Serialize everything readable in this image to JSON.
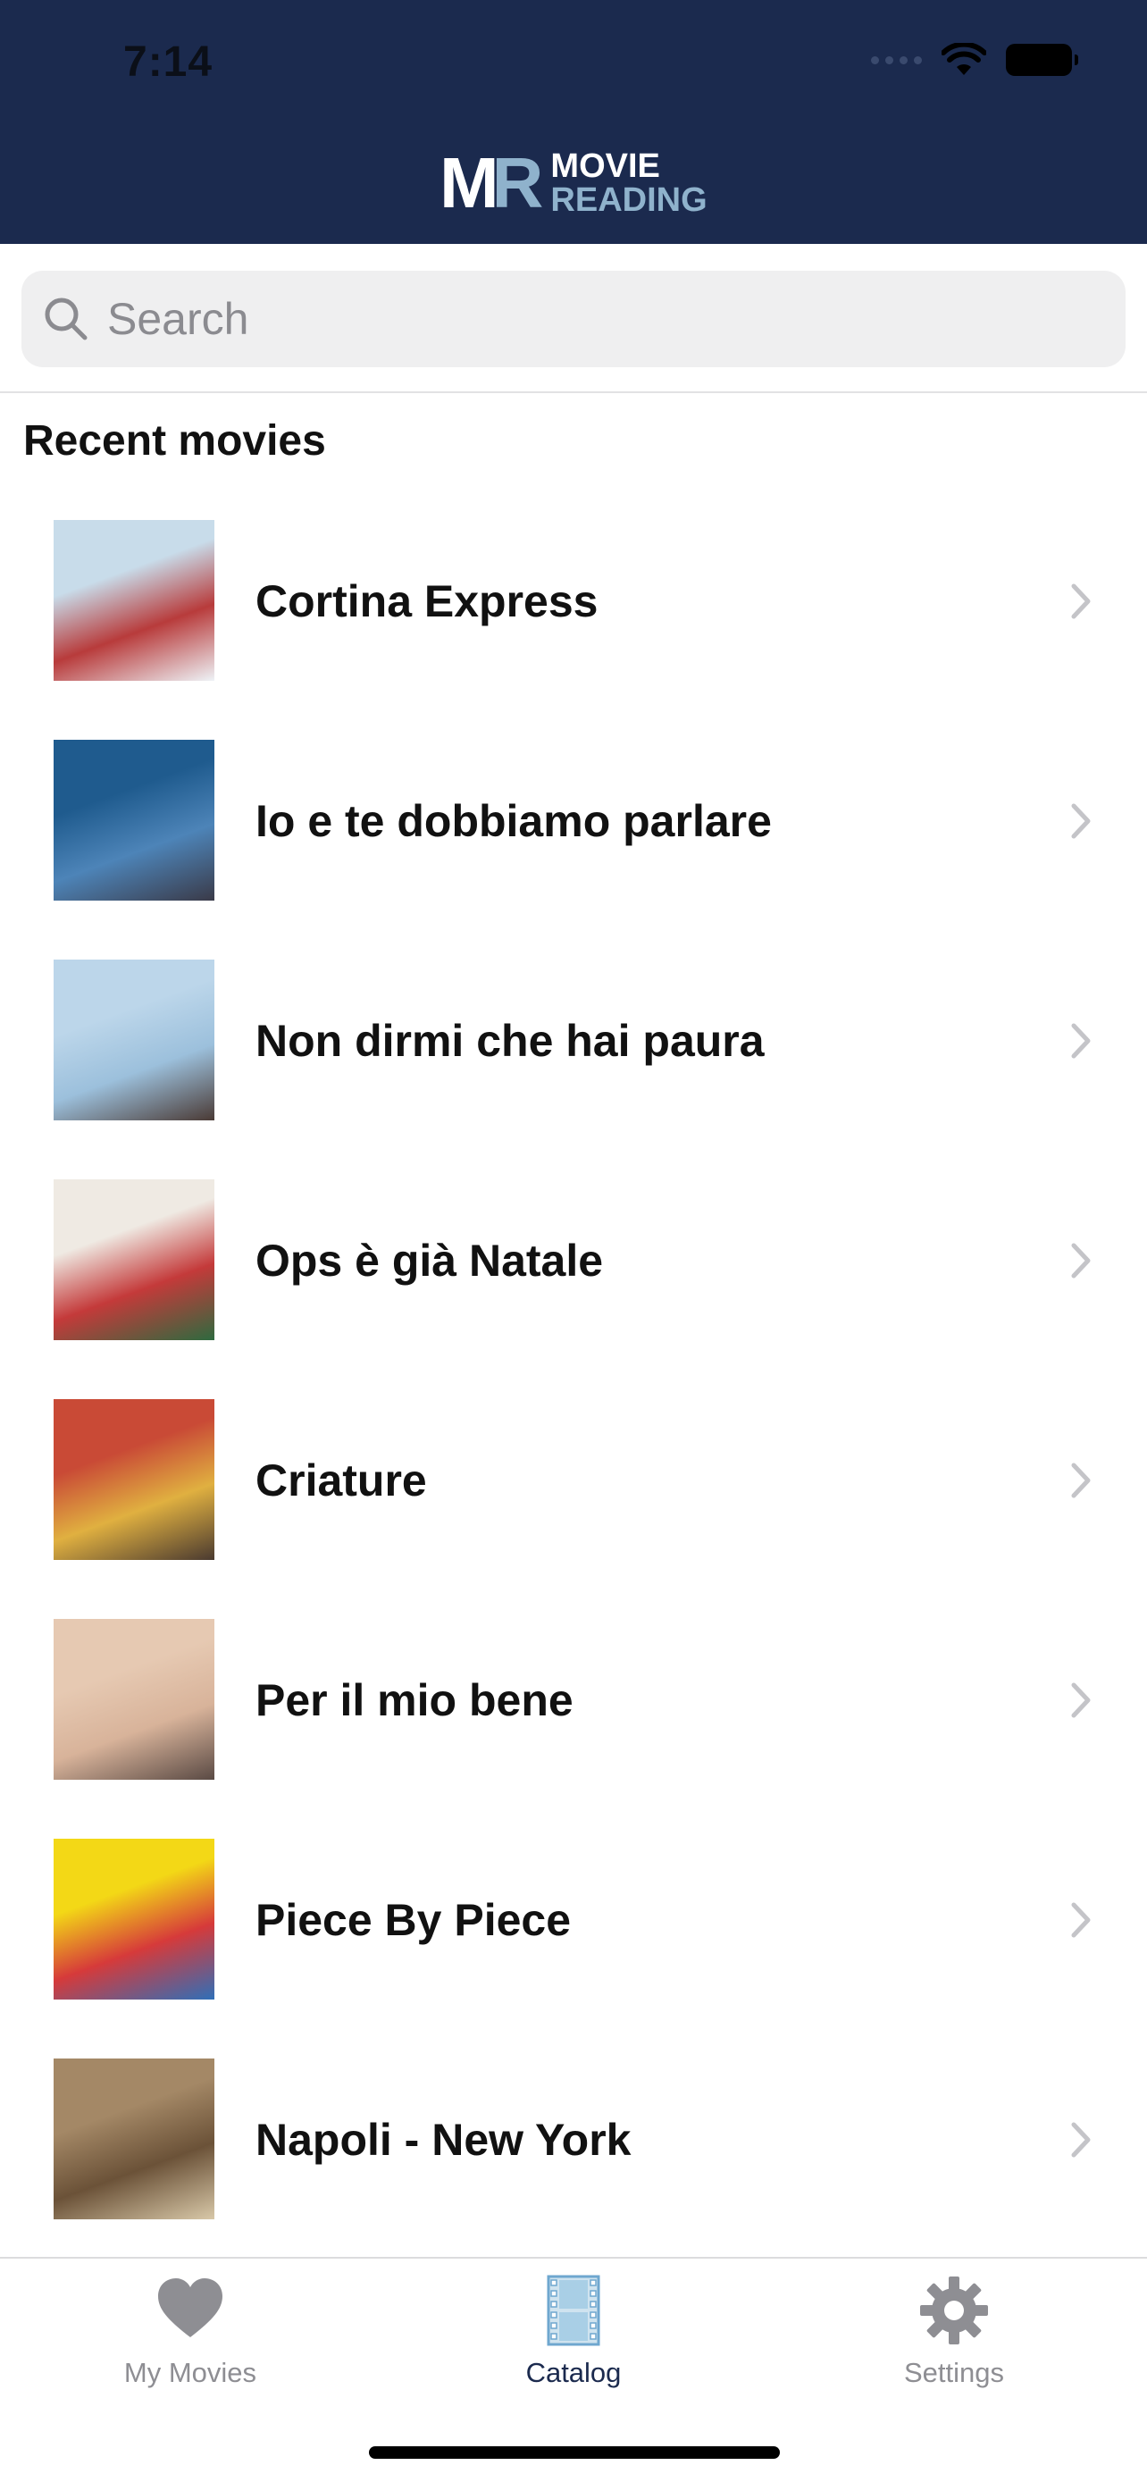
{
  "status_bar": {
    "time": "7:14"
  },
  "header": {
    "logo_mark_left": "M",
    "logo_mark_right": "R",
    "logo_line1": "MOVIE",
    "logo_line2": "READING"
  },
  "search": {
    "placeholder": "Search",
    "value": ""
  },
  "section": {
    "title": "Recent movies"
  },
  "movies": [
    {
      "title": "Cortina Express",
      "colors": [
        "#c8dcea",
        "#b83b3b",
        "#eef3f7"
      ]
    },
    {
      "title": "Io e te dobbiamo parlare",
      "colors": [
        "#1f5b8e",
        "#4d84b8",
        "#3a3a48"
      ]
    },
    {
      "title": "Non dirmi che hai paura",
      "colors": [
        "#bcd6ea",
        "#9cc0dc",
        "#4a3a35"
      ]
    },
    {
      "title": "Ops è già Natale",
      "colors": [
        "#efeae3",
        "#c43a3a",
        "#2e6a3f"
      ]
    },
    {
      "title": "Criature",
      "colors": [
        "#c94a36",
        "#e0b040",
        "#4a3a30"
      ]
    },
    {
      "title": "Per il mio bene",
      "colors": [
        "#e6c9b2",
        "#d8b39a",
        "#5a4a44"
      ]
    },
    {
      "title": "Piece By Piece",
      "colors": [
        "#f3d816",
        "#d63a3a",
        "#2f6fb8"
      ]
    },
    {
      "title": "Napoli - New York",
      "colors": [
        "#a48866",
        "#6b5238",
        "#d8c8a8"
      ]
    }
  ],
  "tabbar": {
    "tabs": [
      {
        "label": "My Movies",
        "icon": "heart-icon",
        "active": false
      },
      {
        "label": "Catalog",
        "icon": "film-icon",
        "active": true
      },
      {
        "label": "Settings",
        "icon": "gear-icon",
        "active": false
      }
    ]
  },
  "colors": {
    "header_bg": "#1b2a4e",
    "accent": "#1b2a4e",
    "logo_light": "#8fb2cc"
  }
}
